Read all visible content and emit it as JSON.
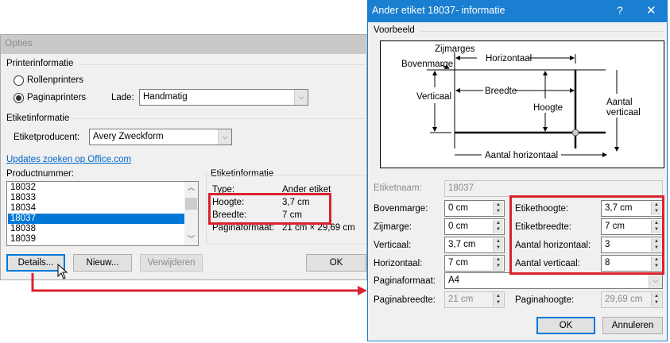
{
  "options_dialog": {
    "title": "Opties",
    "printer_group": "Printerinformatie",
    "radio_roll": "Rollenprinters",
    "radio_page": "Paginaprinters",
    "selected_printer": "Paginaprinters",
    "tray_label": "Lade:",
    "tray_value": "Handmatig",
    "label_group": "Etiketinformatie",
    "vendor_label": "Etiketproducent:",
    "vendor_value": "Avery Zweckform",
    "update_link": "Updates zoeken op Office.com",
    "product_label": "Productnummer:",
    "products": [
      "18032",
      "18033",
      "18034",
      "18037",
      "18038",
      "18039"
    ],
    "selected_product": "18037",
    "info_group": "Etiketinformatie",
    "info": [
      {
        "label": "Type:",
        "value": "Ander etiket"
      },
      {
        "label": "Hoogte:",
        "value": "3,7 cm"
      },
      {
        "label": "Breedte:",
        "value": "7 cm"
      },
      {
        "label": "Paginaformaat:",
        "value": "21 cm × 29,69 cm"
      }
    ],
    "buttons": {
      "details": "Details...",
      "new": "Nieuw...",
      "delete": "Verwijderen",
      "ok": "OK"
    }
  },
  "info_dialog": {
    "title": "Ander etiket 18037- informatie",
    "help": "?",
    "close": "✕",
    "preview_group": "Voorbeeld",
    "diagram": {
      "side_margins": "Zijmarges",
      "horizontal": "Horizontaal",
      "top_margin": "Bovenmarge",
      "vertical": "Verticaal",
      "width": "Breedte",
      "height": "Hoogte",
      "count_vertical_1": "Aantal",
      "count_vertical_2": "verticaal",
      "count_horizontal": "Aantal horizontaal"
    },
    "name_label": "Etiketnaam:",
    "name_value": "18037",
    "fields_left": [
      {
        "label": "Bovenmarge:",
        "value": "0 cm"
      },
      {
        "label": "Zijmarge:",
        "value": "0 cm"
      },
      {
        "label": "Verticaal:",
        "value": "3,7 cm"
      },
      {
        "label": "Horizontaal:",
        "value": "7 cm"
      }
    ],
    "fields_right": [
      {
        "label": "Etikethoogte:",
        "value": "3,7 cm"
      },
      {
        "label": "Etiketbreedte:",
        "value": "7 cm"
      },
      {
        "label": "Aantal horizontaal:",
        "value": "3"
      },
      {
        "label": "Aantal verticaal:",
        "value": "8"
      }
    ],
    "page_size_label": "Paginaformaat:",
    "page_size_value": "A4",
    "page_width_label": "Paginabreedte:",
    "page_width_value": "21 cm",
    "page_height_label": "Paginahoogte:",
    "page_height_value": "29,69 cm",
    "buttons": {
      "ok": "OK",
      "cancel": "Annuleren"
    }
  },
  "colors": {
    "highlight": "#d9232d",
    "selection": "#0078d7",
    "title_active": "#1a7fd0",
    "link": "#0066cc"
  }
}
